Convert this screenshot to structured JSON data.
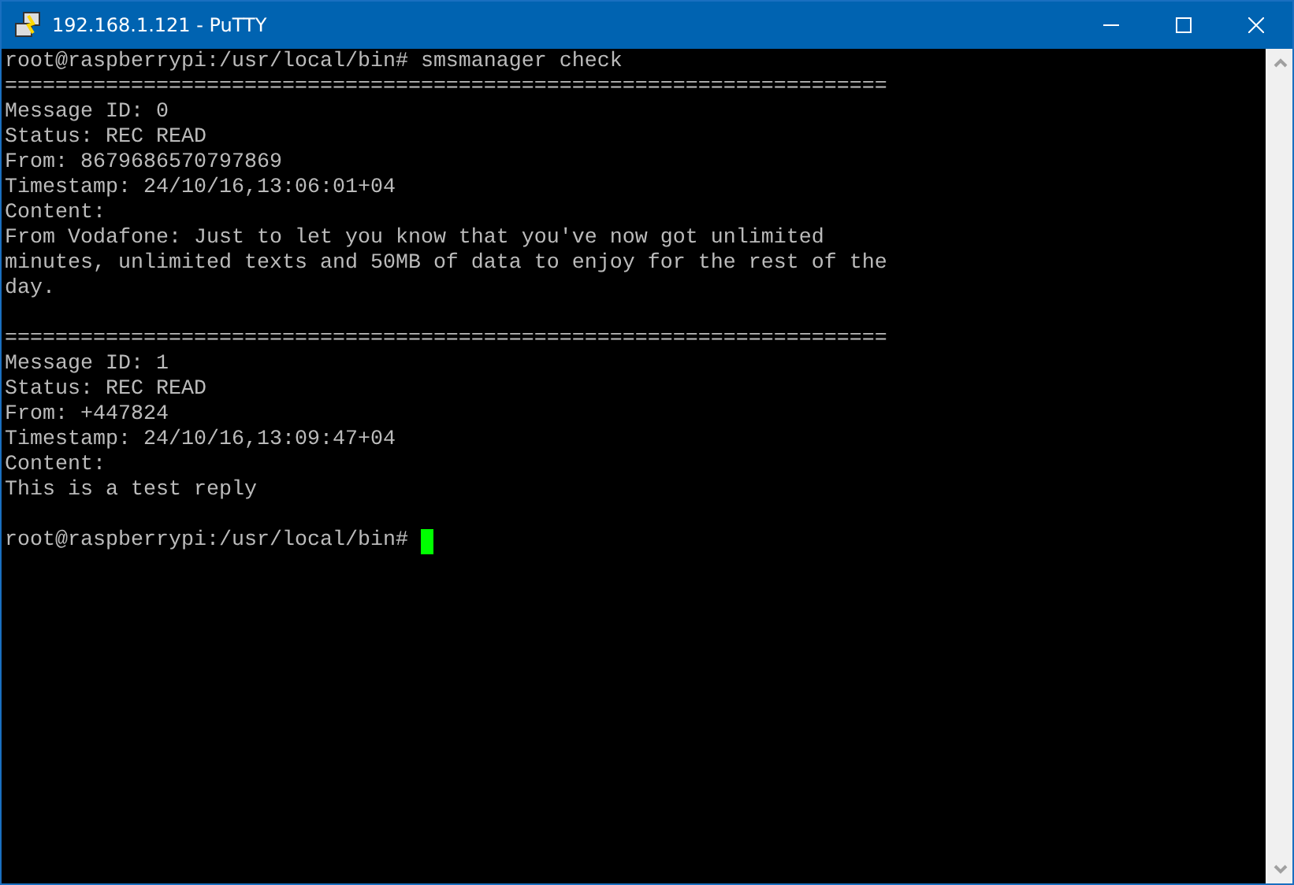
{
  "window": {
    "title": "192.168.1.121 - PuTTY"
  },
  "terminal": {
    "lines": [
      {
        "kind": "text",
        "text": "root@raspberrypi:/usr/local/bin# smsmanager check"
      },
      {
        "kind": "text",
        "text": "======================================================================"
      },
      {
        "kind": "text",
        "text": "Message ID: 0"
      },
      {
        "kind": "text",
        "text": "Status: REC READ"
      },
      {
        "kind": "text",
        "text": "From: 8679686570797869"
      },
      {
        "kind": "text",
        "text": "Timestamp: 24/10/16,13:06:01+04"
      },
      {
        "kind": "text",
        "text": "Content:"
      },
      {
        "kind": "text",
        "text": "From Vodafone: Just to let you know that you've now got unlimited"
      },
      {
        "kind": "text",
        "text": "minutes, unlimited texts and 50MB of data to enjoy for the rest of the"
      },
      {
        "kind": "text",
        "text": "day."
      },
      {
        "kind": "blank"
      },
      {
        "kind": "text",
        "text": "======================================================================"
      },
      {
        "kind": "text",
        "text": "Message ID: 1"
      },
      {
        "kind": "text",
        "text": "Status: REC READ"
      },
      {
        "kind": "text",
        "text": "From: +447824"
      },
      {
        "kind": "text",
        "text": "Timestamp: 24/10/16,13:09:47+04"
      },
      {
        "kind": "text",
        "text": "Content:"
      },
      {
        "kind": "text",
        "text": "This is a test reply"
      },
      {
        "kind": "blank"
      },
      {
        "kind": "prompt",
        "text": "root@raspberrypi:/usr/local/bin#"
      }
    ]
  }
}
